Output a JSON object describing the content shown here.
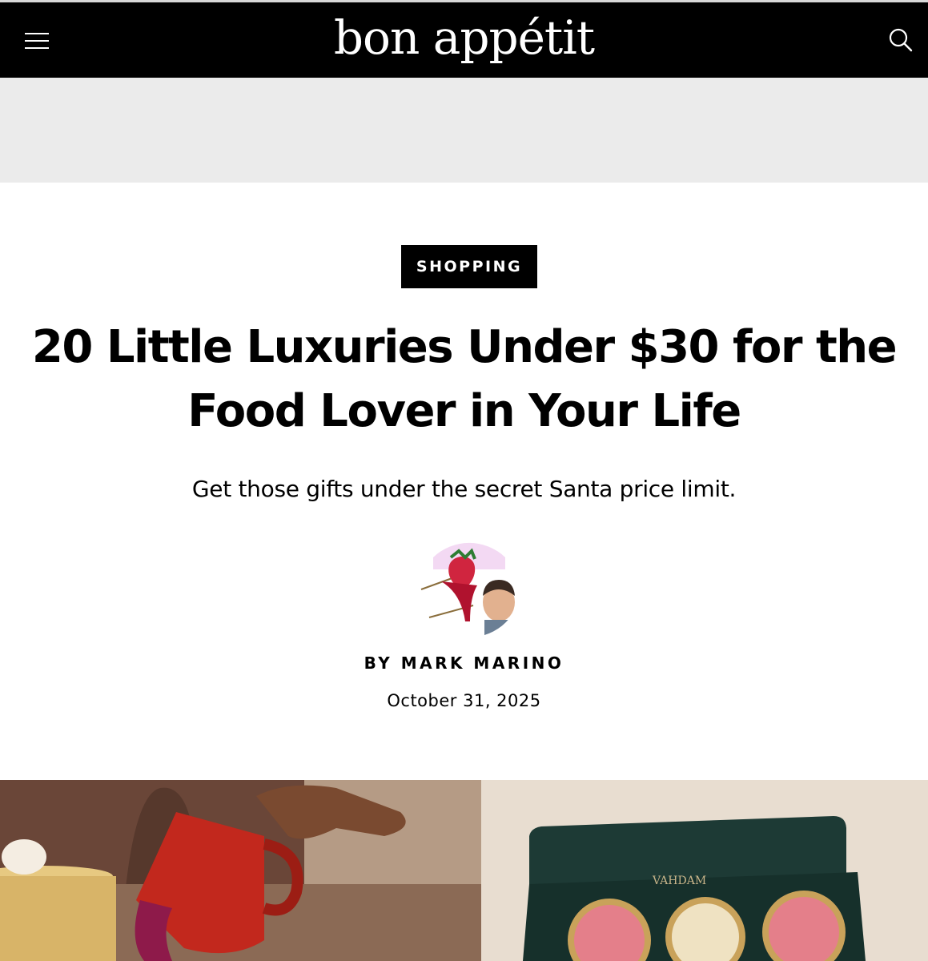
{
  "header": {
    "logo": "bon appétit",
    "menu_icon": "hamburger-menu-icon",
    "search_icon": "search-icon",
    "background": "#000000"
  },
  "article": {
    "category": "SHOPPING",
    "headline_line1": "20 Little Luxuries Under $30 for the",
    "headline_line2": "Food Lover in Your Life",
    "dek": "Get those gifts under the secret Santa price limit.",
    "byline_prefix": "BY",
    "author": "MARK MARINO",
    "date": "October 31, 2025"
  },
  "images": {
    "right_brand": "VAHDAM"
  }
}
